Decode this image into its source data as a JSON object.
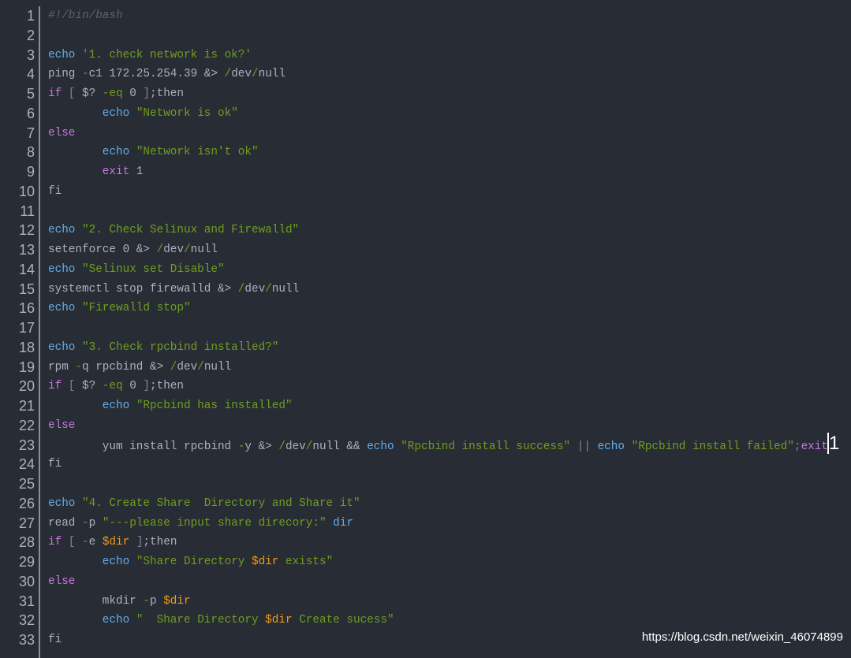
{
  "editor": {
    "language": "bash",
    "colors": {
      "background": "#282c34",
      "text": "#abb2bf",
      "keyword": "#c678dd",
      "builtin": "#61aeee",
      "string": "#6f9f1f",
      "variable": "#f29b17",
      "comment": "#5c6370"
    },
    "cursor_line": 23,
    "lines": [
      [
        [
          "c",
          "#!/bin/bash"
        ]
      ],
      [],
      [
        [
          "b",
          "echo"
        ],
        [
          "t",
          " "
        ],
        [
          "s",
          "'1. check network is ok?'"
        ]
      ],
      [
        [
          "t",
          "ping "
        ],
        [
          "s",
          "-"
        ],
        [
          "t",
          "c1 172.25.254.39 &> "
        ],
        [
          "s",
          "/"
        ],
        [
          "t",
          "dev"
        ],
        [
          "s",
          "/"
        ],
        [
          "t",
          "null"
        ]
      ],
      [
        [
          "k",
          "if"
        ],
        [
          "p",
          " [ "
        ],
        [
          "t",
          "$? "
        ],
        [
          "s",
          "-eq"
        ],
        [
          "t",
          " 0 "
        ],
        [
          "p",
          "]"
        ],
        [
          "t",
          ";then"
        ]
      ],
      [
        [
          "t",
          "        "
        ],
        [
          "b",
          "echo"
        ],
        [
          "t",
          " "
        ],
        [
          "s",
          "\"Network is ok\""
        ]
      ],
      [
        [
          "k",
          "else"
        ]
      ],
      [
        [
          "t",
          "        "
        ],
        [
          "b",
          "echo"
        ],
        [
          "t",
          " "
        ],
        [
          "s",
          "\"Network isn't ok\""
        ]
      ],
      [
        [
          "t",
          "        "
        ],
        [
          "k",
          "exit"
        ],
        [
          "t",
          " 1"
        ]
      ],
      [
        [
          "t",
          "fi"
        ]
      ],
      [],
      [
        [
          "b",
          "echo"
        ],
        [
          "t",
          " "
        ],
        [
          "s",
          "\"2. Check Selinux and Firewalld\""
        ]
      ],
      [
        [
          "t",
          "setenforce 0 &> "
        ],
        [
          "s",
          "/"
        ],
        [
          "t",
          "dev"
        ],
        [
          "s",
          "/"
        ],
        [
          "t",
          "null"
        ]
      ],
      [
        [
          "b",
          "echo"
        ],
        [
          "t",
          " "
        ],
        [
          "s",
          "\"Selinux set Disable\""
        ]
      ],
      [
        [
          "t",
          "systemctl stop firewalld &> "
        ],
        [
          "s",
          "/"
        ],
        [
          "t",
          "dev"
        ],
        [
          "s",
          "/"
        ],
        [
          "t",
          "null"
        ]
      ],
      [
        [
          "b",
          "echo"
        ],
        [
          "t",
          " "
        ],
        [
          "s",
          "\"Firewalld stop\""
        ]
      ],
      [],
      [
        [
          "b",
          "echo"
        ],
        [
          "t",
          " "
        ],
        [
          "s",
          "\"3. Check rpcbind installed?\""
        ]
      ],
      [
        [
          "t",
          "rpm "
        ],
        [
          "s",
          "-"
        ],
        [
          "t",
          "q rpcbind &> "
        ],
        [
          "s",
          "/"
        ],
        [
          "t",
          "dev"
        ],
        [
          "s",
          "/"
        ],
        [
          "t",
          "null"
        ]
      ],
      [
        [
          "k",
          "if"
        ],
        [
          "p",
          " [ "
        ],
        [
          "t",
          "$? "
        ],
        [
          "s",
          "-eq"
        ],
        [
          "t",
          " 0 "
        ],
        [
          "p",
          "]"
        ],
        [
          "t",
          ";then"
        ]
      ],
      [
        [
          "t",
          "        "
        ],
        [
          "b",
          "echo"
        ],
        [
          "t",
          " "
        ],
        [
          "s",
          "\"Rpcbind has installed\""
        ]
      ],
      [
        [
          "k",
          "else"
        ]
      ],
      [
        [
          "t",
          "        yum install rpcbind "
        ],
        [
          "s",
          "-"
        ],
        [
          "t",
          "y &> "
        ],
        [
          "s",
          "/"
        ],
        [
          "t",
          "dev"
        ],
        [
          "s",
          "/"
        ],
        [
          "t",
          "null && "
        ],
        [
          "b",
          "echo"
        ],
        [
          "t",
          " "
        ],
        [
          "s",
          "\"Rpcbind install success\""
        ],
        [
          "p",
          " || "
        ],
        [
          "b",
          "echo"
        ],
        [
          "t",
          " "
        ],
        [
          "s",
          "\"Rpcbind install failed\""
        ],
        [
          "p",
          ";"
        ],
        [
          "k",
          "exit"
        ],
        [
          "cur",
          "1"
        ]
      ],
      [
        [
          "t",
          "fi"
        ]
      ],
      [],
      [
        [
          "b",
          "echo"
        ],
        [
          "t",
          " "
        ],
        [
          "s",
          "\"4. Create Share  Directory and Share it\""
        ]
      ],
      [
        [
          "t",
          "read "
        ],
        [
          "s",
          "-"
        ],
        [
          "t",
          "p "
        ],
        [
          "s",
          "\"---please input share direcory:\""
        ],
        [
          "t",
          " "
        ],
        [
          "b",
          "dir"
        ]
      ],
      [
        [
          "k",
          "if"
        ],
        [
          "p",
          " [ "
        ],
        [
          "s",
          "-"
        ],
        [
          "t",
          "e "
        ],
        [
          "v",
          "$dir"
        ],
        [
          "p",
          " ]"
        ],
        [
          "t",
          ";then"
        ]
      ],
      [
        [
          "t",
          "        "
        ],
        [
          "b",
          "echo"
        ],
        [
          "t",
          " "
        ],
        [
          "s",
          "\"Share Directory "
        ],
        [
          "v",
          "$dir"
        ],
        [
          "s",
          " exists\""
        ]
      ],
      [
        [
          "k",
          "else"
        ]
      ],
      [
        [
          "t",
          "        mkdir "
        ],
        [
          "s",
          "-"
        ],
        [
          "t",
          "p "
        ],
        [
          "v",
          "$dir"
        ]
      ],
      [
        [
          "t",
          "        "
        ],
        [
          "b",
          "echo"
        ],
        [
          "t",
          " "
        ],
        [
          "s",
          "\"  Share Directory "
        ],
        [
          "v",
          "$dir"
        ],
        [
          "s",
          " Create sucess\""
        ]
      ],
      [
        [
          "t",
          "fi"
        ]
      ]
    ]
  },
  "watermark": "https://blog.csdn.net/weixin_46074899"
}
